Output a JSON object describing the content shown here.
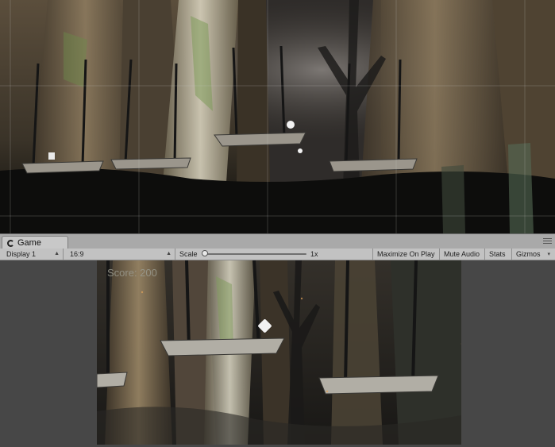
{
  "game_tab": {
    "label": "Game",
    "icon": "pacman-icon"
  },
  "toolbar": {
    "display": "Display 1",
    "aspect": "16:9",
    "scale_label": "Scale",
    "scale_value": "1x",
    "scale_level": 0.0,
    "maximize_on_play": "Maximize On Play",
    "mute_audio": "Mute Audio",
    "stats": "Stats",
    "gizmos": "Gizmos"
  },
  "game": {
    "score_text": "Score: 200"
  },
  "colors": {
    "tab_bar": "#a9a9a9",
    "toolbar": "#c2c2c2",
    "game_bg": "#474747"
  }
}
